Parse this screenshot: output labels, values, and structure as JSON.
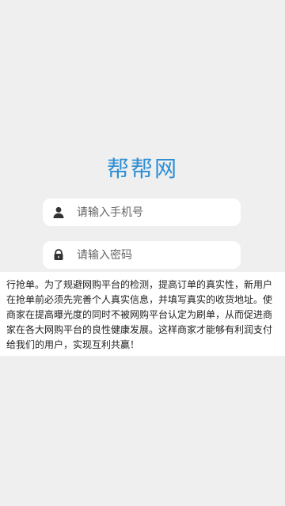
{
  "app": {
    "title": "帮帮网"
  },
  "login": {
    "phone_placeholder": "请输入手机号",
    "password_placeholder": "请输入密码",
    "phone_icon": "user-icon",
    "password_icon": "lock-icon"
  },
  "notice": {
    "text": "行抢单。为了规避网购平台的检测，提高订单的真实性，新用户在抢单前必须先完善个人真实信息，并填写真实的收货地址。使商家在提高曝光度的同时不被网购平台认定为刷单，从而促进商家在各大网购平台的良性健康发展。这样商家才能够有利润支付给我们的用户，实现互利共赢！"
  },
  "colors": {
    "background": "#efefef",
    "brand": "#2f8fd3",
    "input_background": "#ffffff",
    "notice_background": "#ffffff"
  }
}
